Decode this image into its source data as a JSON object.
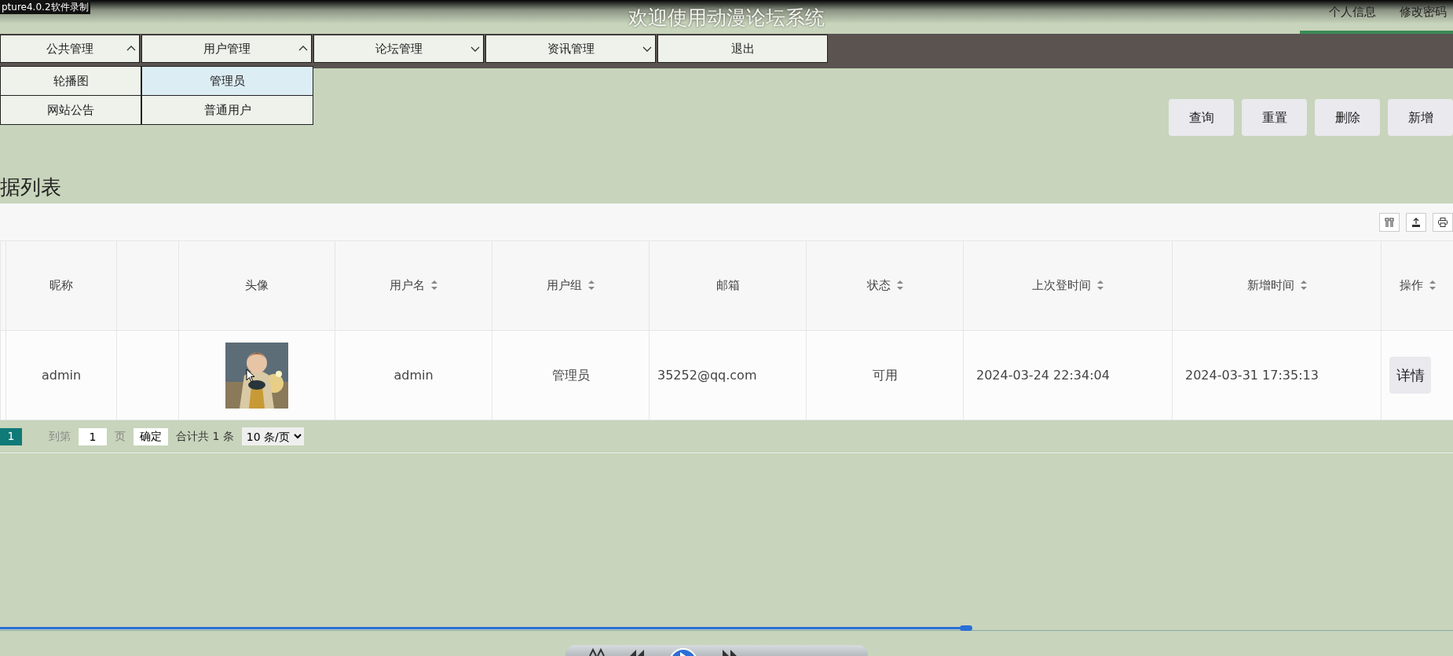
{
  "recorder_title": "pture4.0.2软件录制",
  "header": {
    "title": "欢迎使用动漫论坛系统",
    "user_links": [
      {
        "label": "个人信息",
        "selected": false
      },
      {
        "label": "修改密码",
        "selected": false
      }
    ]
  },
  "menu": [
    {
      "label": "公共管理",
      "kind": "dropdown",
      "expanded": true,
      "children": [
        {
          "label": "轮播图",
          "selected": false
        },
        {
          "label": "网站公告",
          "selected": false
        }
      ]
    },
    {
      "label": "用户管理",
      "kind": "dropdown",
      "expanded": true,
      "children": [
        {
          "label": "管理员",
          "selected": true
        },
        {
          "label": "普通用户",
          "selected": false
        }
      ]
    },
    {
      "label": "论坛管理",
      "kind": "dropdown",
      "expanded": false
    },
    {
      "label": "资讯管理",
      "kind": "dropdown",
      "expanded": false
    },
    {
      "label": "退出",
      "kind": "link"
    }
  ],
  "actions": [
    "查询",
    "重置",
    "删除",
    "新增"
  ],
  "section_title": "据列表",
  "table": {
    "columns": [
      {
        "label": "昵称",
        "sortable": false
      },
      {
        "sortable": false
      },
      {
        "label": "头像",
        "sortable": false
      },
      {
        "label": "用户名",
        "sortable": true
      },
      {
        "label": "用户组",
        "sortable": true
      },
      {
        "label": "邮箱",
        "sortable": false
      },
      {
        "label": "状态",
        "sortable": true
      },
      {
        "label": "上次登时间",
        "sortable": true
      },
      {
        "label": "新增时间",
        "sortable": true
      },
      {
        "label": "操作",
        "sortable": true
      }
    ],
    "rows": [
      {
        "nickname": "admin",
        "username": "admin",
        "group": "管理员",
        "email": "35252@qq.com",
        "status": "可用",
        "last_login": "2024-03-24 22:34:04",
        "created": "2024-03-31 17:35:13",
        "action": "详情"
      }
    ]
  },
  "pagination": {
    "pages": [
      {
        "label": "1",
        "selected": true
      }
    ],
    "goto_label": "到第",
    "goto_value": "1",
    "page_unit": "页",
    "confirm": "确定",
    "total": "合计共 1 条",
    "page_size": "10 条/页"
  },
  "player": {
    "level": 0.665
  }
}
